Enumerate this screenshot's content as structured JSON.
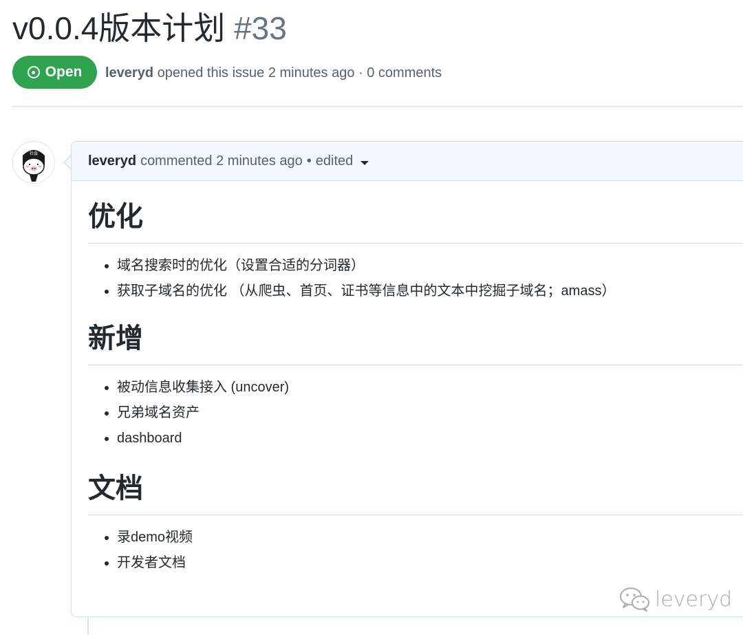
{
  "issue": {
    "title": "v0.0.4版本计划",
    "number": "#33",
    "state": "Open",
    "author": "leveryd",
    "meta": "opened this issue 2 minutes ago · 0 comments"
  },
  "comment": {
    "author": "leveryd",
    "action": "commented 2 minutes ago",
    "separator": "•",
    "edited": "edited",
    "avatar_text": "社会",
    "sections": [
      {
        "heading": "优化",
        "items": [
          "域名搜索时的优化（设置合适的分词器）",
          "获取子域名的优化 （从爬虫、首页、证书等信息中的文本中挖掘子域名；amass）"
        ]
      },
      {
        "heading": "新增",
        "items": [
          "被动信息收集接入 (uncover)",
          "兄弟域名资产",
          "dashboard"
        ]
      },
      {
        "heading": "文档",
        "items": [
          "录demo视频",
          "开发者文档"
        ]
      }
    ]
  },
  "watermark": {
    "text": "leveryd",
    "icon": "wechat-icon"
  },
  "colors": {
    "open_green": "#2ea44f",
    "comment_header_bg": "#f1f8ff",
    "comment_border": "#c8e1ff",
    "muted_text": "#586069",
    "text": "#24292e"
  }
}
